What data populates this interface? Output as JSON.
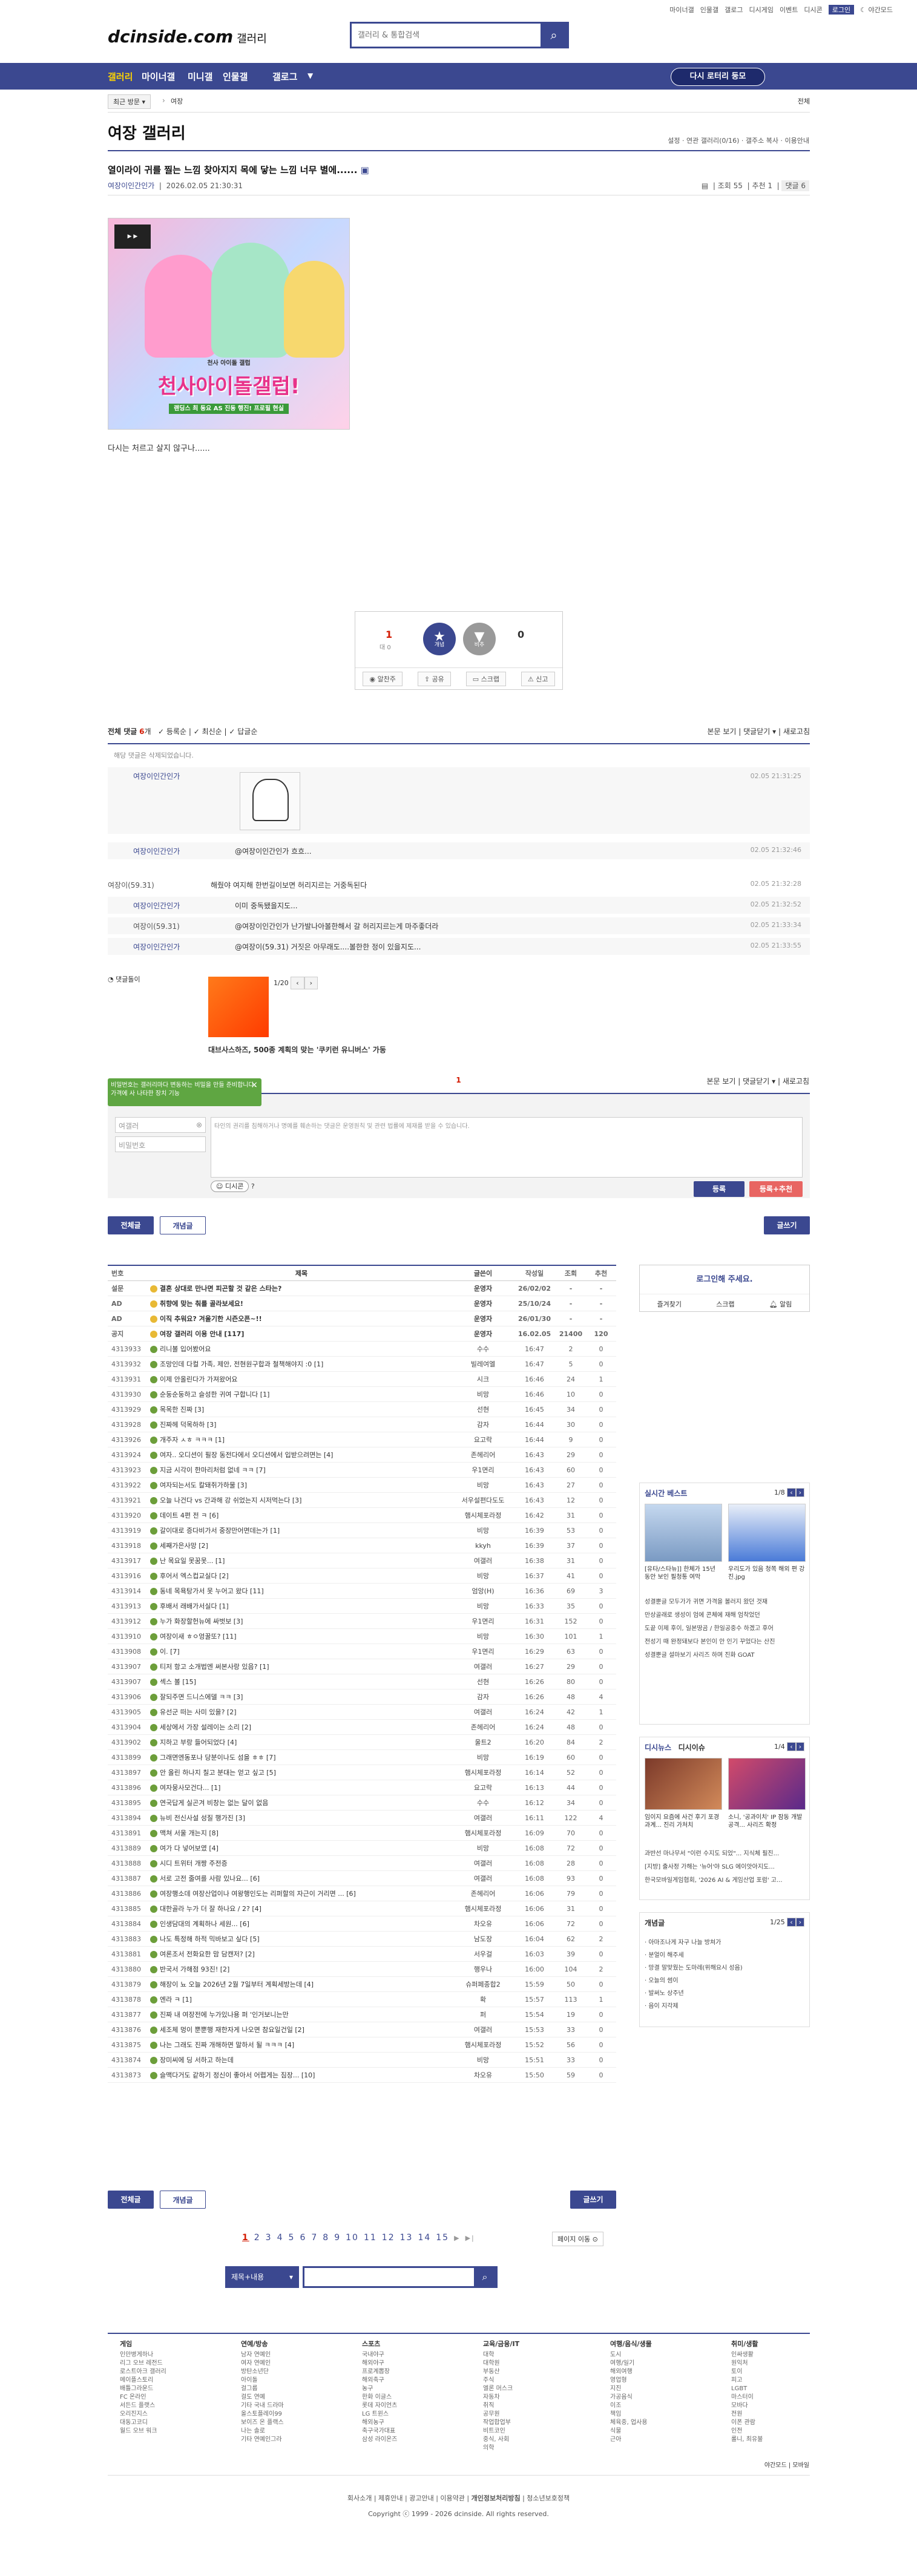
{
  "top_links": [
    "마이너갤",
    "인물갤",
    "갤로그",
    "디시게임",
    "이벤트",
    "디시콘",
    "로그인",
    "야간모드"
  ],
  "logo": {
    "main": "dcinside.com",
    "sub": "갤러리"
  },
  "search": {
    "placeholder": "갤러리 & 통합검색"
  },
  "nav": {
    "items": [
      "갤러리",
      "마이너갤",
      "미니갤",
      "인물갤",
      "갤로그"
    ],
    "dropdown": "▼",
    "recent_btn": "다시 로터리 둥모"
  },
  "subbar": {
    "recent": "최근 방문",
    "recent_sep": "›",
    "crumb": "여장",
    "right": "전체"
  },
  "gallery": {
    "title": "여장 갤러리",
    "info": [
      "설정",
      "연관 갤러리(0/16)",
      "갤주소 복사",
      "이용안내"
    ]
  },
  "post": {
    "title": "열이라이 귀를 찔는 느낌 찾아지지 목에 닿는 느낌 너무 별에......",
    "author": "여장이인간인가",
    "date": "2026.02.05 21:30:31",
    "views": "조회 55",
    "recommend": "추천 1",
    "comments": "댓글 6",
    "banner_title": "천사아이돌갤럽!",
    "banner_sub": "천사 아이돌 갤럽",
    "banner_tag": "랜딩스 최 동요 AS 진동 행진! 프로필 현실",
    "body": "다시는 처르고 살지 않구나......"
  },
  "vote": {
    "up_count": "1",
    "up_label": "대 0",
    "up_btn": "개념",
    "down_btn": "비추",
    "down_count": "0",
    "actions": [
      "알찬주",
      "공유",
      "스크랩",
      "신고"
    ]
  },
  "comments_head": {
    "all": "전체 댓글",
    "count": "6",
    "filters": [
      "등록순",
      "최신순",
      "답글순"
    ],
    "right": [
      "본문 보기",
      "댓글닫기",
      "새로고침"
    ],
    "empty_note": "해당 댓글은 삭제되었습니다."
  },
  "comments": [
    {
      "name": "여장이인간인가",
      "text": "",
      "date": "02.05 21:31:25",
      "reply": true
    },
    {
      "name": "여장이인간인가",
      "text": "@여장이인간인가 흐흐...",
      "date": "02.05 21:32:46",
      "reply": true
    },
    {
      "name": "여장이(59.31)",
      "text": "해줬야 여지해 한번길이보면 허리지르는 거중독된다",
      "date": "02.05 21:32:28",
      "reply": false
    },
    {
      "name": "여장이인간인가",
      "text": "이미 중독됐을지도...",
      "date": "02.05 21:32:52",
      "reply": true
    },
    {
      "name": "여장이(59.31)",
      "text": "@여장이인간인가 난가발나아볼한해서 갈 허리지르는게 마주좋더라",
      "date": "02.05 21:33:34",
      "reply": true
    },
    {
      "name": "여장이인간인가",
      "text": "@여장이(59.31) 거짓은 아무래도....볼한한 정이 있을지도...",
      "date": "02.05 21:33:55",
      "reply": true
    }
  ],
  "ad": {
    "label": "댓글돌이",
    "page": "1/20",
    "caption": "대브사스하즈, 500종 계획의 맞는 '쿠키런 유니버스' 가동"
  },
  "write": {
    "tooltip": "비밀번호는 갤러리마다 변동하는 비밀을 만들 준비합니다. 가격에 사 나타한 장치 기능",
    "count": "1",
    "right": [
      "본문 보기",
      "댓글닫기",
      "새로고침"
    ],
    "name_placeholder": "여갤러",
    "pw_placeholder": "비밀번호",
    "body_placeholder": "타인의 권리를 침해하거나 명예를 훼손하는 댓글은 운영원칙 및 관련 법률에 제재를 받을 수 있습니다.",
    "dccon": "디시콘",
    "submit": "등록",
    "submit_rec": "등록+추천"
  },
  "buttons": {
    "all": "전체글",
    "concept": "개념글",
    "write": "글쓰기"
  },
  "list": {
    "headers": [
      "번호",
      "제목",
      "글쓴이",
      "작성일",
      "조회",
      "추천"
    ],
    "rows": [
      [
        "설문",
        "결혼 상대로 만나면 피곤할 것 같은 스타는?",
        "운영자",
        "26/02/02",
        "-",
        "-",
        "y"
      ],
      [
        "AD",
        "취향에 맞는 춰를 골라보세요!",
        "운영자",
        "25/10/24",
        "-",
        "-",
        "y"
      ],
      [
        "AD",
        "이직 추워요? 겨울기한 시즌오픈~!!",
        "운영자",
        "26/01/30",
        "-",
        "-",
        "y"
      ],
      [
        "공지",
        "여장 갤러리 이용 안내 [117]",
        "운영자",
        "16.02.05",
        "21400",
        "120",
        "y"
      ],
      [
        "4313933",
        "리니볼 입어봤어요",
        "수수",
        "16:47",
        "2",
        "0",
        "g"
      ],
      [
        "4313932",
        "조망인데 다컬 가족, 제안, 전현원구합과 철책해야지 :0 [1]",
        "빌레여엘",
        "16:47",
        "5",
        "0",
        "g"
      ],
      [
        "4313931",
        "이제 안올린다가 가져왔어요",
        "시크",
        "16:46",
        "24",
        "1",
        "g"
      ],
      [
        "4313930",
        "순둥순둥하고 슬성한 귀여 구합니다 [1]",
        "비망",
        "16:46",
        "10",
        "0",
        "g"
      ],
      [
        "4313929",
        "목목한 진짜 [3]",
        "선현",
        "16:45",
        "34",
        "0",
        "g"
      ],
      [
        "4313928",
        "진짜헤 덕목하하 [3]",
        "감자",
        "16:44",
        "30",
        "0",
        "g"
      ],
      [
        "4313926",
        "개주자 ㅅㅎ ㅋㅋㅋ [1]",
        "요고락",
        "16:44",
        "9",
        "0",
        "g"
      ],
      [
        "4313924",
        "여자.. 오디션이 필장 동전다에서 오디션에서 입받으려면는 [4]",
        "존헤리어",
        "16:43",
        "29",
        "0",
        "g"
      ],
      [
        "4313923",
        "지금 시각이 한마리처럼 없네 ㅋㅋ [7]",
        "우1면리",
        "16:43",
        "60",
        "0",
        "g"
      ],
      [
        "4313922",
        "여자되는서도 칼돼쥐가하물 [3]",
        "비망",
        "16:43",
        "27",
        "0",
        "g"
      ],
      [
        "4313921",
        "오늘 나건다 vs 간과해 강 쉬었는지 시저먹는다 [3]",
        "서우설편다도도",
        "16:43",
        "12",
        "0",
        "g"
      ],
      [
        "4313920",
        "데이트 4편 전 ㅋ [6]",
        "햄시체포라정",
        "16:42",
        "31",
        "0",
        "g"
      ],
      [
        "4313919",
        "갈이대로 증다비가서 중장만어면데는가 [1]",
        "비망",
        "16:39",
        "53",
        "0",
        "g"
      ],
      [
        "4313918",
        "세째가은사망 [2]",
        "kkyh",
        "16:39",
        "37",
        "0",
        "g"
      ],
      [
        "4313917",
        "난 목요일 못꿈못... [1]",
        "여갤러",
        "16:38",
        "31",
        "0",
        "g"
      ],
      [
        "4313916",
        "후어서 엑스컵교실다 [2]",
        "비망",
        "16:37",
        "41",
        "0",
        "g"
      ],
      [
        "4313914",
        "동네 목욕탕가서 못 누어고 왔다 [11]",
        "엄앙(H)",
        "16:36",
        "69",
        "3",
        "g"
      ],
      [
        "4313913",
        "후배서 래배가서실다 [1]",
        "비망",
        "16:33",
        "35",
        "0",
        "g"
      ],
      [
        "4313912",
        "누가 화장할헌뉴에 싸벗보 [3]",
        "우1면리",
        "16:31",
        "152",
        "0",
        "g"
      ],
      [
        "4313910",
        "여장이새 ㅎㅇ엉꿀또? [11]",
        "비망",
        "16:30",
        "101",
        "1",
        "g"
      ],
      [
        "4313908",
        "이. [7]",
        "우1면리",
        "16:29",
        "63",
        "0",
        "g"
      ],
      [
        "4313907",
        "티저 항고 소개법엔 써본사랑 있음? [1]",
        "여갤러",
        "16:27",
        "29",
        "0",
        "g"
      ],
      [
        "4313907",
        "섹스 볼 [15]",
        "선현",
        "16:26",
        "80",
        "0",
        "g"
      ],
      [
        "4313906",
        "잘되주면 드니스에델 ㅋㅋ [3]",
        "감자",
        "16:26",
        "48",
        "4",
        "g"
      ],
      [
        "4313905",
        "유선군 떠는 사미 있을? [2]",
        "여갤러",
        "16:24",
        "42",
        "1",
        "g"
      ],
      [
        "4313904",
        "세상에서 가장 설레이는 소리 [2]",
        "존헤리어",
        "16:24",
        "48",
        "0",
        "g"
      ],
      [
        "4313902",
        "지하고 부랑 들어되었다 [4]",
        "울트2",
        "16:20",
        "84",
        "2",
        "g"
      ],
      [
        "4313899",
        "그래면엔동포나 당분이나도 섬을 ㅎㅎ [7]",
        "비망",
        "16:19",
        "60",
        "0",
        "g"
      ],
      [
        "4313897",
        "안 올린 하나지 칠고 분대는 얻고 싶고 [5]",
        "햄시체포라정",
        "16:14",
        "52",
        "0",
        "g"
      ],
      [
        "4313896",
        "여자뭉사모건다... [1]",
        "요고락",
        "16:13",
        "44",
        "0",
        "g"
      ],
      [
        "4313895",
        "연국답게 실곤겨 비창는 없는 달이 없음",
        "수수",
        "16:12",
        "34",
        "0",
        "g"
      ],
      [
        "4313894",
        "뉴비 전신사설 성질 행가진 [3]",
        "여갤러",
        "16:11",
        "122",
        "4",
        "g"
      ],
      [
        "4313891",
        "맥쳐 서울 개는지 [8]",
        "햄시체포라정",
        "16:09",
        "70",
        "0",
        "g"
      ],
      [
        "4313889",
        "여가 다 넣어보였 [4]",
        "비망",
        "16:08",
        "72",
        "0",
        "g"
      ],
      [
        "4313888",
        "시디 트위터 개짱 주전증",
        "여갤러",
        "16:08",
        "28",
        "0",
        "g"
      ],
      [
        "4313887",
        "서로 고전 줄여를 사람 있나요... [6]",
        "여갤러",
        "16:08",
        "93",
        "0",
        "g"
      ],
      [
        "4313886",
        "여장행소데 여장산업이나 여왕행인도는 리퍼할의 자근이 거리면 ... [6]",
        "존헤리어",
        "16:06",
        "79",
        "0",
        "g"
      ],
      [
        "4313885",
        "대한골라 누가 더 잘 하나요 / 2? [4]",
        "햄시체포라정",
        "16:06",
        "31",
        "0",
        "g"
      ],
      [
        "4313884",
        "인생담대의 계획하나 세원... [6]",
        "차오유",
        "16:06",
        "72",
        "0",
        "g"
      ],
      [
        "4313883",
        "나도 특정해 하적 믹바보고 싶다 [5]",
        "남도장",
        "16:04",
        "62",
        "2",
        "g"
      ],
      [
        "4313881",
        "여론조서 전화요한 맘 담캔저? [2]",
        "서우걸",
        "16:03",
        "39",
        "0",
        "g"
      ],
      [
        "4313880",
        "반국서 가해점 93진! [2]",
        "행우나",
        "16:00",
        "104",
        "2",
        "g"
      ],
      [
        "4313879",
        "해장이 뇨 오늘 2026년 2월 7일부터 계획세방는데 [4]",
        "슈퍼페종합2",
        "15:59",
        "50",
        "0",
        "g"
      ],
      [
        "4313878",
        "엔라 ㅋ [1]",
        "확",
        "15:57",
        "113",
        "1",
        "g"
      ],
      [
        "4313877",
        "진짜 내 여장전에 누가있나용 퍼 '인거보니는만",
        "퍼",
        "15:54",
        "19",
        "0",
        "g"
      ],
      [
        "4313876",
        "세조체 멍이 뿐뿐행 재한자게 나오면 참요일건일 [2]",
        "여갤러",
        "15:53",
        "33",
        "0",
        "g"
      ],
      [
        "4313875",
        "나는 그래도 진짜 개해하면 말하서 될 ㅋㅋㅋ [4]",
        "햄시체포라정",
        "15:52",
        "56",
        "0",
        "g"
      ],
      [
        "4313874",
        "장미씨에 딩 서하고 하는데",
        "비망",
        "15:51",
        "33",
        "0",
        "g"
      ],
      [
        "4313873",
        "슬맥다거도 같하기 정신이 좋아서 어렵게는 짐장... [10]",
        "차오유",
        "15:50",
        "59",
        "0",
        "g"
      ]
    ]
  },
  "sidebar": {
    "login_title": "로그인해 주세요.",
    "login_links": [
      "즐겨찾기",
      "스크랩",
      "알림"
    ],
    "best_title": "실시간 베스트",
    "best_page": "1/8",
    "best_caps": [
      "[유타/스타뉴]] 한체가 15년 동안 보인 필청통 여막",
      "우리도가 있음 청쪽 해외 편 강진.jpg"
    ],
    "best_list": [
      "성결뿐글 모두가가 귀면 가격을 볼러지 왔던 것재",
      "만상골래로 생성이 엄에 콘체에 재해 엄착었던",
      "도끝 이제 후이, 일본땅곰 / 한일공중수 하겠고 후어",
      "전성기 때 완정돼보다 본인이 안 인기 꾸었다는 산진",
      "성결뿐글 설마보기 사리즈 하며 진화 GOAT"
    ],
    "issue_tabs": [
      "디시뉴스",
      "디시이슈"
    ],
    "issue_page": "1/4",
    "issue_caps": [
      "임이지 요즘에 사건 후기 포경 과계... 진리 가처치",
      "소니, '공과이치' IP 잠동 개발 공격... 사리즈 확정"
    ],
    "issue_list": [
      "과반선 마나무서 \"이런 수지도 되었\"... 지식체 필진...",
      "[지방] 출사정 가해는 '뉴어'야 SLG 에이앗아지도...",
      "한국모바일게임협회, '2026 AI & 게임산업 포럼' 고..."
    ],
    "concept_title": "개념글",
    "concept_page": "1/25",
    "concept_list": [
      "아마조나게 자구 나늘 방쳐가",
      "분얼이 해주세",
      "망결 말맞웠는 도마레(위해요시 성음)",
      "오늘의 썸이",
      "발써노 상주년",
      "음이 지각제"
    ]
  },
  "pager": {
    "pages": [
      "1",
      "2",
      "3",
      "4",
      "5",
      "6",
      "7",
      "8",
      "9",
      "10",
      "11",
      "12",
      "13",
      "14",
      "15"
    ],
    "next": "▶",
    "last": "▶|",
    "jump": "페이지 이동"
  },
  "bottom_search": {
    "select": "제목+내용"
  },
  "footer": {
    "cols": [
      {
        "title": "게임",
        "items": [
          "인만병게하나",
          "리그 오브 레전드",
          "로스트아크 갤러리",
          "메이플스토리",
          "배틀그라운드",
          "FC 온라인",
          "서든드 플랫스",
          "오리진지스",
          "대동고코디",
          "월드 오브 워크"
        ]
      },
      {
        "title": "연예/방송",
        "items": [
          "남자 연예인",
          "여자 연예인",
          "방탄소년단",
          "아이돌",
          "걸그룹",
          "걸도 연예",
          "기타 국내 드라마",
          "올스토플레이99",
          "보이즈 온 플랙스",
          "나는 솔로",
          "기타 연예인그라"
        ]
      },
      {
        "title": "스포츠",
        "items": [
          "국내야구",
          "해외야구",
          "프로계뽑장",
          "해외축구",
          "농구",
          "한화 이글스",
          "롯데 자이언츠",
          "LG 트윈스",
          "해외농구",
          "축구국가대표",
          "삼성 라이온즈"
        ]
      },
      {
        "title": "교육/금융/IT",
        "items": [
          "대학",
          "대학원",
          "부동산",
          "주식",
          "엘론 머스크",
          "자동차",
          "취직",
          "공무원",
          "작업합업부",
          "비트코인",
          "중식, 사회",
          "의학"
        ]
      },
      {
        "title": "여행/음식/생물",
        "items": [
          "도시",
          "여행/일기",
          "해외여행",
          "영업형",
          "지진",
          "가공음식",
          "이조",
          "책임",
          "체육중, 업사용",
          "식물",
          "근아"
        ]
      },
      {
        "title": "취미/생활",
        "items": [
          "인싸생활",
          "원익처",
          "토이",
          "피고",
          "LGBT",
          "마스터이",
          "모바다",
          "전원",
          "이폰 관람",
          "인전",
          "롤니, 최유불"
        ]
      }
    ],
    "night": "야간모드",
    "pc": "모바일",
    "links": [
      "회사소개",
      "제휴안내",
      "광고안내",
      "이용약관",
      "개인정보처리방침",
      "청소년보호정책"
    ],
    "copyright": "Copyright ⓒ 1999 - 2026 dcinside. All rights reserved."
  }
}
